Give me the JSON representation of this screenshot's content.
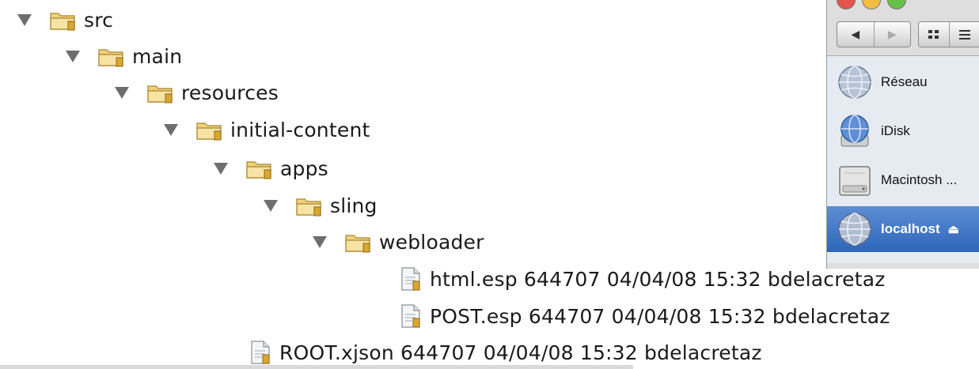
{
  "tree": {
    "folders": [
      {
        "label": "src"
      },
      {
        "label": "main"
      },
      {
        "label": "resources"
      },
      {
        "label": "initial-content"
      },
      {
        "label": "apps"
      },
      {
        "label": "sling"
      },
      {
        "label": "webloader"
      }
    ],
    "files": [
      {
        "label": "html.esp 644707  04/04/08 15:32  bdelacretaz"
      },
      {
        "label": "POST.esp 644707  04/04/08 15:32  bdelacretaz"
      },
      {
        "label": "ROOT.xjson 644707  04/04/08 15:32  bdelacretaz"
      }
    ]
  },
  "finder": {
    "sidebar_items": [
      {
        "label": "Réseau",
        "icon": "globe-icon"
      },
      {
        "label": "iDisk",
        "icon": "idisk-icon"
      },
      {
        "label": "Macintosh ...",
        "icon": "hard-drive-icon"
      },
      {
        "label": "localhost",
        "icon": "server-globe-icon",
        "selected": true
      }
    ],
    "selection_color": "#3a72c6"
  }
}
